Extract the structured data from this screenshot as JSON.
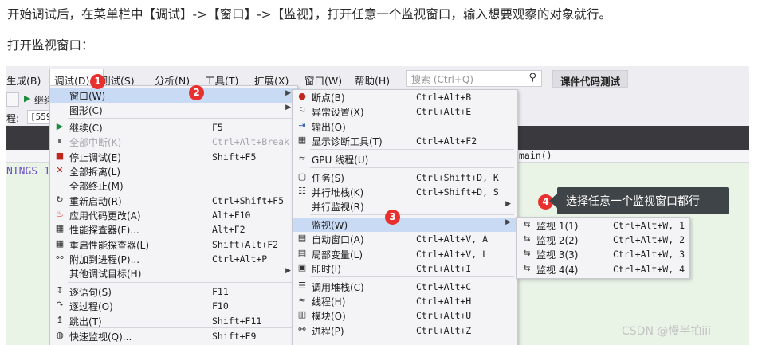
{
  "article": {
    "intro": "开始调试后，在菜单栏中【调试】->【窗口】->【监视】，打开任意一个监视窗口，输入想要观察的对象就行。",
    "subhead": "打开监视窗口："
  },
  "menubar": {
    "items": [
      "生成(B)",
      "调试(D)",
      "测试(S)",
      "分析(N)",
      "工具(T)",
      "扩展(X)",
      "窗口(W)",
      "帮助(H)"
    ],
    "search_placeholder": "搜索 (Ctrl+Q)",
    "course_button": "课件代码测试"
  },
  "toolbar": {
    "continue_label": "继续",
    "process_label": "程:",
    "process_value": "[559"
  },
  "tabstrip": {
    "function": "main()"
  },
  "editor": {
    "code_fragment": "NINGS 1"
  },
  "debug_menu": {
    "items": [
      {
        "label": "窗口(W)",
        "shortcut": "",
        "icon": "",
        "submenu": true,
        "highlight": true
      },
      {
        "label": "图形(C)",
        "shortcut": "",
        "icon": "",
        "submenu": true
      },
      {
        "label": "继续(C)",
        "shortcut": "F5",
        "icon": "▶"
      },
      {
        "label": "全部中断(K)",
        "shortcut": "Ctrl+Alt+Break",
        "icon": "⏸",
        "disabled": true
      },
      {
        "label": "停止调试(E)",
        "shortcut": "Shift+F5",
        "icon": "■"
      },
      {
        "label": "全部拆离(L)",
        "shortcut": "",
        "icon": "✕"
      },
      {
        "label": "全部终止(M)",
        "shortcut": "",
        "icon": ""
      },
      {
        "label": "重新启动(R)",
        "shortcut": "Ctrl+Shift+F5",
        "icon": "↻"
      },
      {
        "label": "应用代码更改(A)",
        "shortcut": "Alt+F10",
        "icon": "♨"
      },
      {
        "label": "性能探查器(F)...",
        "shortcut": "Alt+F2",
        "icon": "▦"
      },
      {
        "label": "重启性能探查器(L)",
        "shortcut": "Shift+Alt+F2",
        "icon": "▦"
      },
      {
        "label": "附加到进程(P)...",
        "shortcut": "Ctrl+Alt+P",
        "icon": "⚯"
      },
      {
        "label": "其他调试目标(H)",
        "shortcut": "",
        "icon": "",
        "submenu": true
      },
      {
        "label": "逐语句(S)",
        "shortcut": "F11",
        "icon": "↧"
      },
      {
        "label": "逐过程(O)",
        "shortcut": "F10",
        "icon": "↷"
      },
      {
        "label": "跳出(T)",
        "shortcut": "Shift+F11",
        "icon": "↥"
      },
      {
        "label": "快速监视(Q)...",
        "shortcut": "Shift+F9",
        "icon": "◍"
      }
    ]
  },
  "window_menu": {
    "items": [
      {
        "label": "断点(B)",
        "shortcut": "Ctrl+Alt+B",
        "icon": "●"
      },
      {
        "label": "异常设置(X)",
        "shortcut": "Ctrl+Alt+E",
        "icon": "⚐"
      },
      {
        "label": "输出(O)",
        "shortcut": "",
        "icon": "⇥"
      },
      {
        "label": "显示诊断工具(T)",
        "shortcut": "Ctrl+Alt+F2",
        "icon": "▦"
      },
      {
        "label": "GPU 线程(U)",
        "shortcut": "",
        "icon": "≈"
      },
      {
        "label": "任务(S)",
        "shortcut": "Ctrl+Shift+D, K",
        "icon": "▢"
      },
      {
        "label": "并行堆栈(K)",
        "shortcut": "Ctrl+Shift+D, S",
        "icon": "☷"
      },
      {
        "label": "并行监视(R)",
        "shortcut": "",
        "icon": "",
        "submenu": true
      },
      {
        "label": "监视(W)",
        "shortcut": "",
        "icon": "",
        "submenu": true,
        "highlight": true
      },
      {
        "label": "自动窗口(A)",
        "shortcut": "Ctrl+Alt+V, A",
        "icon": "▤"
      },
      {
        "label": "局部变量(L)",
        "shortcut": "Ctrl+Alt+V, L",
        "icon": "▤"
      },
      {
        "label": "即时(I)",
        "shortcut": "Ctrl+Alt+I",
        "icon": "▣"
      },
      {
        "label": "调用堆栈(C)",
        "shortcut": "Ctrl+Alt+C",
        "icon": "☰"
      },
      {
        "label": "线程(H)",
        "shortcut": "Ctrl+Alt+H",
        "icon": "≈"
      },
      {
        "label": "模块(O)",
        "shortcut": "Ctrl+Alt+U",
        "icon": "▥"
      },
      {
        "label": "进程(P)",
        "shortcut": "Ctrl+Alt+Z",
        "icon": "⚯"
      }
    ]
  },
  "watch_menu": {
    "items": [
      {
        "label": "监视 1(1)",
        "shortcut": "Ctrl+Alt+W, 1",
        "icon": "⇆"
      },
      {
        "label": "监视 2(2)",
        "shortcut": "Ctrl+Alt+W, 2",
        "icon": "⇆"
      },
      {
        "label": "监视 3(3)",
        "shortcut": "Ctrl+Alt+W, 3",
        "icon": "⇆"
      },
      {
        "label": "监视 4(4)",
        "shortcut": "Ctrl+Alt+W, 4",
        "icon": "⇆"
      }
    ]
  },
  "annotations": {
    "badges": [
      "1",
      "2",
      "3",
      "4"
    ],
    "callout": "选择任意一个监视窗口都行"
  },
  "watermark": "CSDN @慢半拍iii",
  "colors": {
    "menu_highlight": "#c9daf5",
    "badge_red": "#e8312f",
    "callout_bg": "#3f4448",
    "editor_bg": "#e9f3e6"
  }
}
